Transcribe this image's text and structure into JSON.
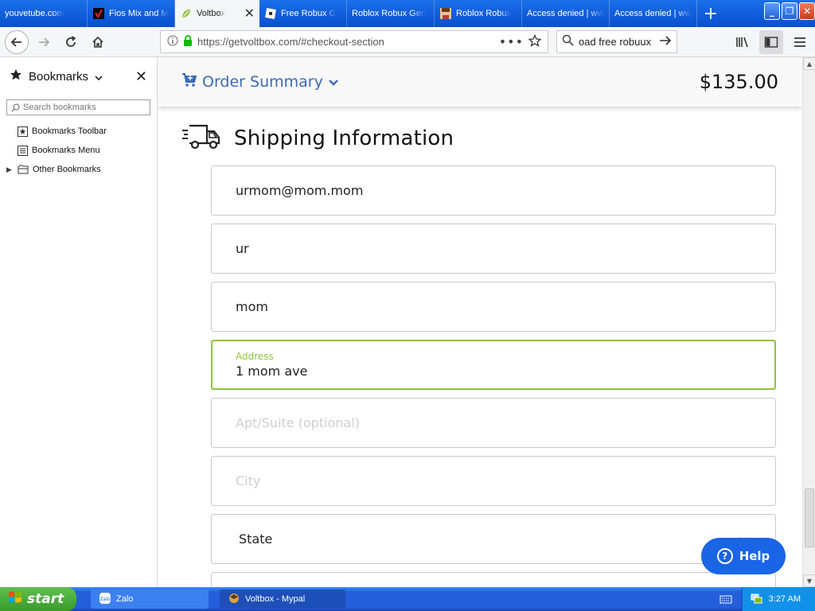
{
  "browser": {
    "tabs": [
      {
        "label": "youvetube.com",
        "icon": "none"
      },
      {
        "label": "Fios Mix and M",
        "icon": "verizon-check-icon"
      },
      {
        "label": "Voltbox",
        "icon": "voltbox-leaf-icon",
        "active": true
      },
      {
        "label": "Free Robux G",
        "icon": "roblox-icon"
      },
      {
        "label": "Roblox Robux Gen",
        "icon": "none"
      },
      {
        "label": "Roblox Robux",
        "icon": "roblox-avatar-icon"
      },
      {
        "label": "Access denied | www",
        "icon": "none"
      },
      {
        "label": "Access denied | www",
        "icon": "none"
      }
    ],
    "url": "https://getvoltbox.com/#checkout-section",
    "search_text": "oad free robuux"
  },
  "sidebar": {
    "title": "Bookmarks",
    "search_placeholder": "Search bookmarks",
    "items": [
      {
        "label": "Bookmarks Toolbar",
        "icon": "bookmarks-toolbar-icon"
      },
      {
        "label": "Bookmarks Menu",
        "icon": "bookmarks-menu-icon"
      },
      {
        "label": "Other Bookmarks",
        "icon": "folder-icon"
      }
    ]
  },
  "checkout": {
    "order_summary_label": "Order Summary",
    "total": "$135.00",
    "shipping_title": "Shipping Information",
    "fields": {
      "email": "urmom@mom.mom",
      "first_name": "ur",
      "last_name": "mom",
      "address_label": "Address",
      "address": "1 mom ave",
      "apt_placeholder": "Apt/Suite (optional)",
      "city_placeholder": "City",
      "state": "State"
    },
    "help_label": "Help",
    "colors": {
      "accent_blue": "#3d6bb3",
      "focus_green": "#8fc43e",
      "help_blue": "#1a64e6"
    }
  },
  "taskbar": {
    "start_label": "start",
    "items": [
      {
        "label": "Zalo"
      },
      {
        "label": "Voltbox - Mypal"
      }
    ],
    "clock": "3:27 AM"
  }
}
